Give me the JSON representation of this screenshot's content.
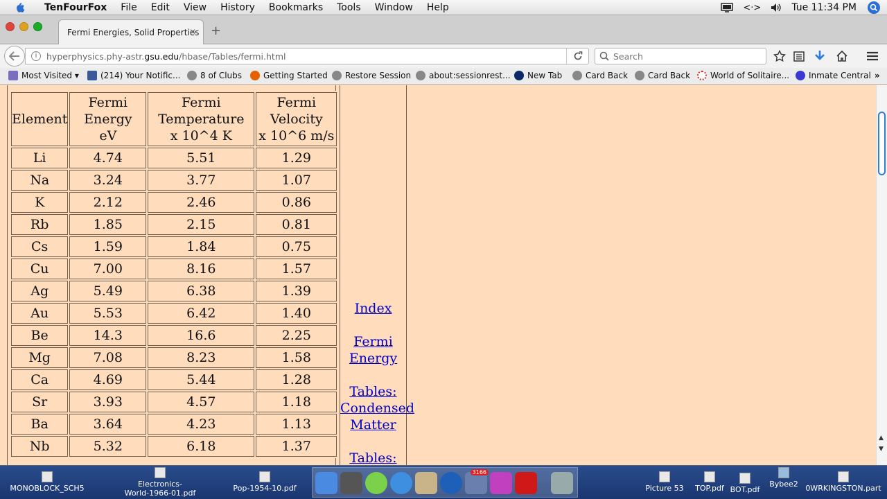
{
  "menubar": {
    "app": "TenFourFox",
    "items": [
      "File",
      "Edit",
      "View",
      "History",
      "Bookmarks",
      "Tools",
      "Window",
      "Help"
    ],
    "clock": "Tue 11:34 PM"
  },
  "tab": {
    "title": "Fermi Energies, Solid Properties"
  },
  "url": {
    "prefix": "hyperphysics.phy-astr.",
    "domain": "gsu.edu",
    "path": "/hbase/Tables/fermi.html"
  },
  "search": {
    "placeholder": "Search"
  },
  "bookmarks": [
    "Most Visited ▾",
    "(214) Your Notific...",
    "8 of Clubs",
    "Getting Started",
    "Restore Session",
    "about:sessionrest...",
    "New Tab",
    "Card Back",
    "Card Back",
    "World of Solitaire...",
    "Inmate Central"
  ],
  "table": {
    "headers": [
      "Element",
      "Fermi\nEnergy\neV",
      "Fermi\nTemperature\nx 10^4 K",
      "Fermi\nVelocity\nx 10^6 m/s"
    ],
    "rows": [
      [
        "Li",
        "4.74",
        "5.51",
        "1.29"
      ],
      [
        "Na",
        "3.24",
        "3.77",
        "1.07"
      ],
      [
        "K",
        "2.12",
        "2.46",
        "0.86"
      ],
      [
        "Rb",
        "1.85",
        "2.15",
        "0.81"
      ],
      [
        "Cs",
        "1.59",
        "1.84",
        "0.75"
      ],
      [
        "Cu",
        "7.00",
        "8.16",
        "1.57"
      ],
      [
        "Ag",
        "5.49",
        "6.38",
        "1.39"
      ],
      [
        "Au",
        "5.53",
        "6.42",
        "1.40"
      ],
      [
        "Be",
        "14.3",
        "16.6",
        "2.25"
      ],
      [
        "Mg",
        "7.08",
        "8.23",
        "1.58"
      ],
      [
        "Ca",
        "4.69",
        "5.44",
        "1.28"
      ],
      [
        "Sr",
        "3.93",
        "4.57",
        "1.18"
      ],
      [
        "Ba",
        "3.64",
        "4.23",
        "1.13"
      ],
      [
        "Nb",
        "5.32",
        "6.18",
        "1.37"
      ]
    ]
  },
  "sidelinks": [
    [
      "Index"
    ],
    [
      "Fermi",
      "Energy"
    ],
    [
      "Tables:",
      "Condensed",
      "Matter"
    ],
    [
      "Tables:"
    ]
  ],
  "dock": {
    "left_items": [
      "MONOBLOCK_SCH5",
      "Electronics-\nWorld-1966-01.pdf",
      "Pop-1954-10.pdf"
    ],
    "right_items": [
      "Picture 53",
      "TOP.pdf",
      "BOT.pdf",
      "Bybee2",
      "0WRKINGSTON.part"
    ],
    "badge": "3166"
  },
  "colors": {
    "page_bg": "#ffdcbc",
    "link": "#0000cc",
    "dock": "#1f3f7f"
  }
}
